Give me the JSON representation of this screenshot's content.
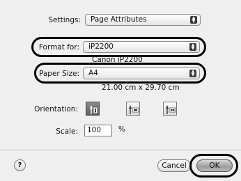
{
  "settings": {
    "label": "Settings:",
    "value": "Page Attributes"
  },
  "format_for": {
    "label": "Format for:",
    "value": "iP2200",
    "printer_name": "Canon iP2200"
  },
  "paper_size": {
    "label": "Paper Size:",
    "value": "A4",
    "dimensions": "21.00 cm x 29.70 cm"
  },
  "orientation": {
    "label": "Orientation:",
    "options": [
      "portrait",
      "landscape",
      "landscape-reversed"
    ],
    "selected": "portrait"
  },
  "scale": {
    "label": "Scale:",
    "value": "100",
    "unit": "%"
  },
  "buttons": {
    "help": "?",
    "cancel": "Cancel",
    "ok": "OK"
  }
}
